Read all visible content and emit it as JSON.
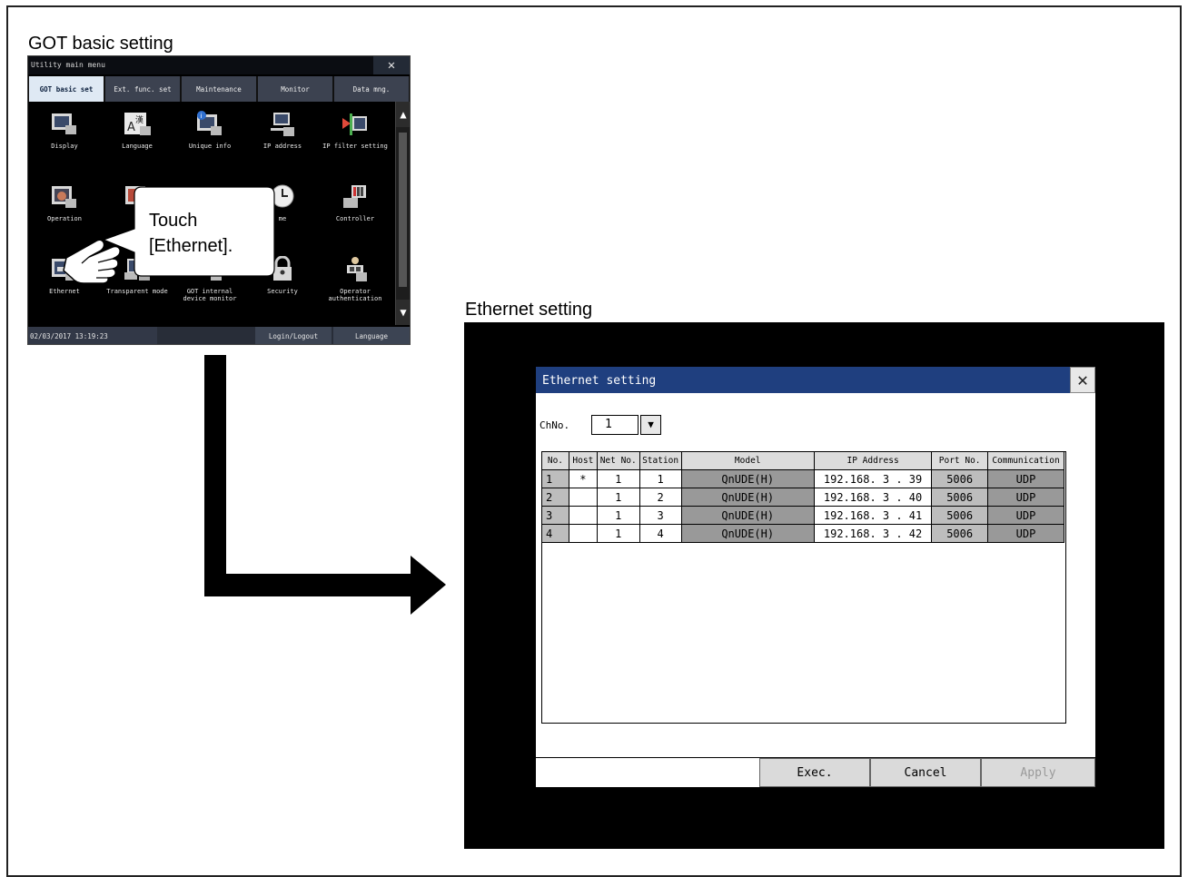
{
  "captions": {
    "got_basic": "GOT basic setting",
    "ethernet": "Ethernet setting"
  },
  "utility_menu": {
    "title": "Utility main menu",
    "tabs": [
      {
        "label": "GOT basic set",
        "active": true
      },
      {
        "label": "Ext. func. set",
        "active": false
      },
      {
        "label": "Maintenance",
        "active": false
      },
      {
        "label": "Monitor",
        "active": false
      },
      {
        "label": "Data mng.",
        "active": false
      }
    ],
    "icons": [
      {
        "label": "Display",
        "icon": "display-icon"
      },
      {
        "label": "Language",
        "icon": "language-icon"
      },
      {
        "label": "Unique info",
        "icon": "unique-info-icon"
      },
      {
        "label": "IP address",
        "icon": "ip-address-icon"
      },
      {
        "label": "IP filter setting",
        "icon": "ip-filter-icon"
      },
      {
        "label": "Operation",
        "icon": "operation-icon"
      },
      {
        "label": "",
        "icon": "hidden-icon"
      },
      {
        "label": "me",
        "icon": "clock-icon"
      },
      {
        "label": "Controller",
        "icon": "controller-icon"
      },
      {
        "label": "Ethernet",
        "icon": "ethernet-icon"
      },
      {
        "label": "Transparent mode",
        "icon": "transparent-mode-icon"
      },
      {
        "label": "GOT internal device monitor",
        "icon": "device-monitor-icon"
      },
      {
        "label": "Security",
        "icon": "security-icon"
      },
      {
        "label": "Operator authentication",
        "icon": "operator-auth-icon"
      }
    ],
    "footer": {
      "datetime": "02/03/2017 13:19:23",
      "login": "Login/Logout",
      "language": "Language"
    }
  },
  "callout": {
    "line1": "Touch",
    "line2": "[Ethernet]."
  },
  "ethernet_setting": {
    "title": "Ethernet setting",
    "chno_label": "ChNo.",
    "chno_value": "1",
    "columns": [
      "No.",
      "Host",
      "Net No.",
      "Station",
      "Model",
      "IP Address",
      "Port No.",
      "Communication"
    ],
    "rows": [
      [
        "1",
        "*",
        "1",
        "1",
        "QnUDE(H)",
        "192.168. 3 . 39",
        "5006",
        "UDP"
      ],
      [
        "2",
        "",
        "1",
        "2",
        "QnUDE(H)",
        "192.168. 3 . 40",
        "5006",
        "UDP"
      ],
      [
        "3",
        "",
        "1",
        "3",
        "QnUDE(H)",
        "192.168. 3 . 41",
        "5006",
        "UDP"
      ],
      [
        "4",
        "",
        "1",
        "4",
        "QnUDE(H)",
        "192.168. 3 . 42",
        "5006",
        "UDP"
      ]
    ],
    "buttons": {
      "exec": "Exec.",
      "cancel": "Cancel",
      "apply": "Apply"
    }
  },
  "colors": {
    "title_bar": "#1f3f7f",
    "active_tab": "#dfe9f4",
    "screen_bg": "#000000"
  }
}
